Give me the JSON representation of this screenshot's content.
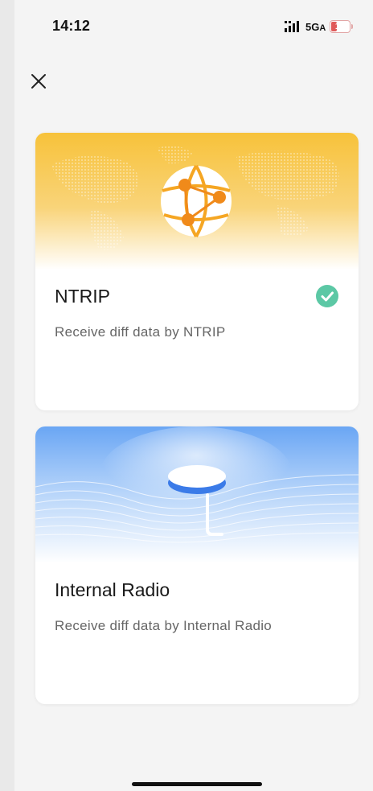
{
  "status_bar": {
    "time": "14:12",
    "network": "5G",
    "network_suffix": "A",
    "battery_level": "15",
    "battery_fraction": 0.15
  },
  "header": {
    "close_icon": "close-icon"
  },
  "options": [
    {
      "title": "NTRIP",
      "description": "Receive diff data by NTRIP",
      "selected": true,
      "icon": "network-globe-icon"
    },
    {
      "title": "Internal Radio",
      "description": "Receive diff data by Internal Radio",
      "selected": false,
      "icon": "radio-antenna-icon"
    }
  ],
  "colors": {
    "ntrip_accent": "#f5a623",
    "radio_accent": "#4a8ef0",
    "selected_check": "#5cc8a5"
  }
}
